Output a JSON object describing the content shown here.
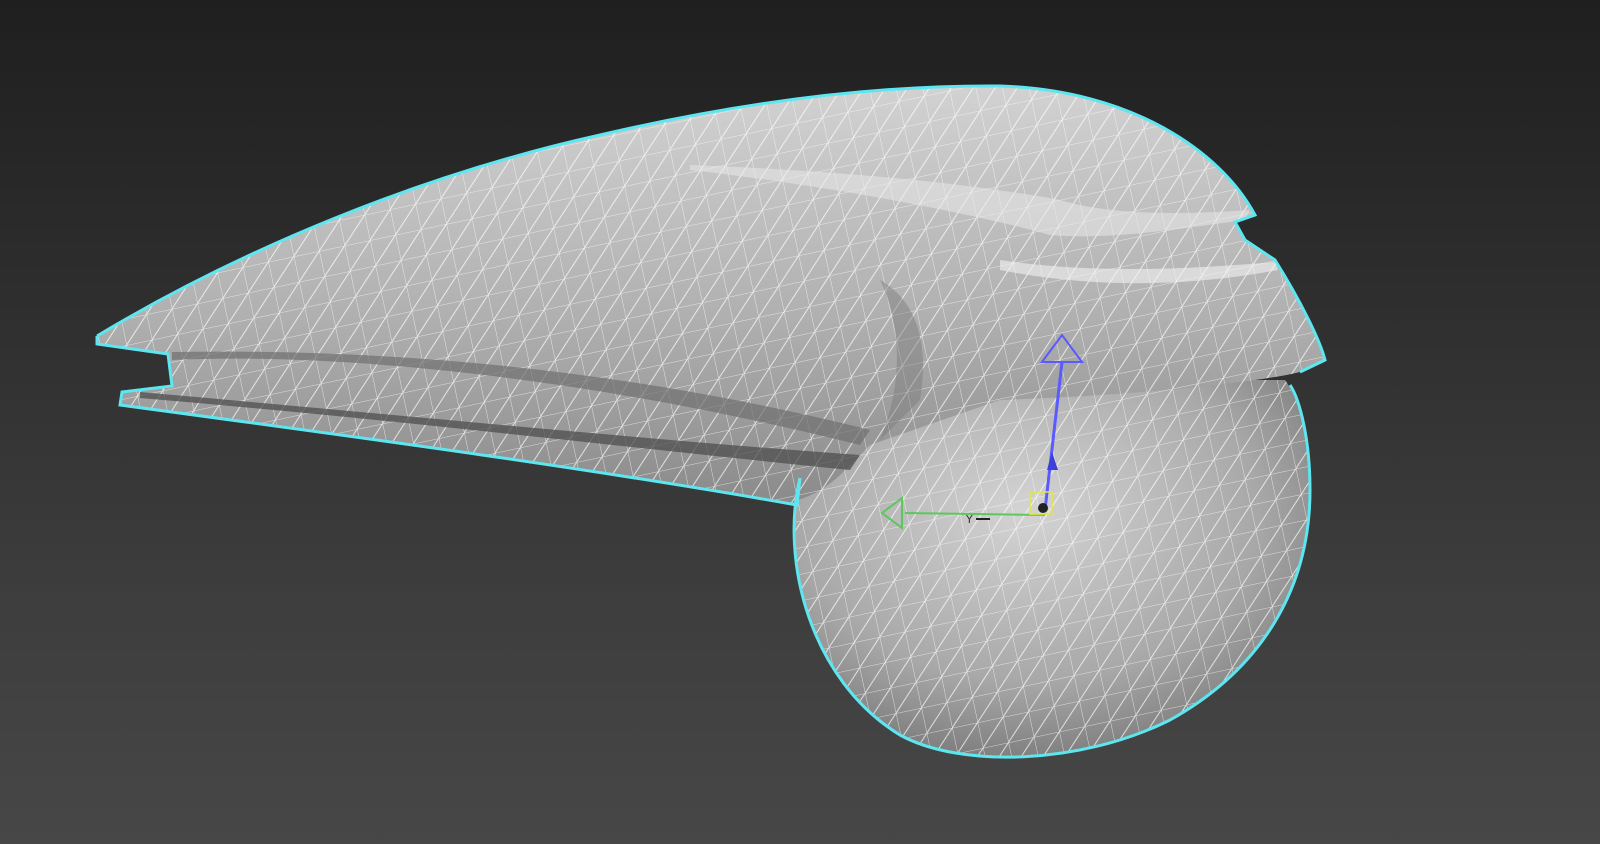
{
  "viewport": {
    "selection_color": "#5ee6f0",
    "wireframe_color": "#ffffff",
    "mesh_color": "#b9b9b9"
  },
  "gizmo": {
    "z_axis_color": "#5a5aff",
    "y_axis_color": "#5cc85c",
    "axis_label": "Y"
  }
}
